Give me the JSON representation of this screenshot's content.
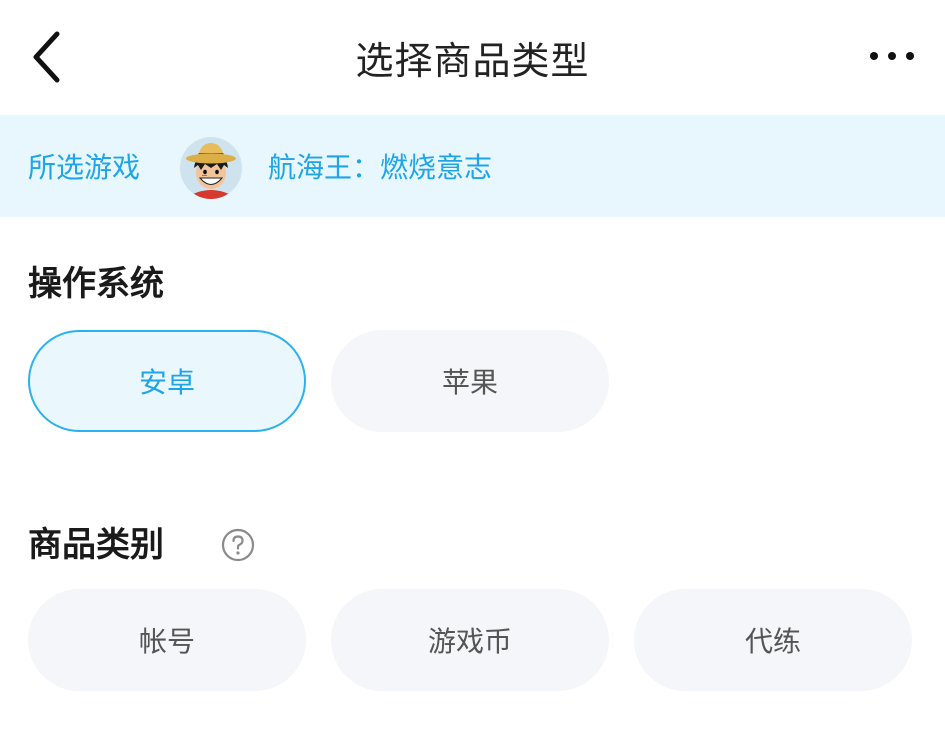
{
  "header": {
    "title": "选择商品类型",
    "back_icon": "chevron-left-icon",
    "more_icon": "more-dots-icon"
  },
  "selected_game": {
    "label": "所选游戏",
    "avatar_icon": "game-avatar",
    "name": "航海王：燃烧意志"
  },
  "os_section": {
    "title": "操作系统",
    "options": [
      {
        "label": "安卓",
        "selected": true
      },
      {
        "label": "苹果",
        "selected": false
      }
    ]
  },
  "category_section": {
    "title": "商品类别",
    "help_icon": "question-circle-icon",
    "options": [
      {
        "label": "帐号",
        "selected": false
      },
      {
        "label": "游戏币",
        "selected": false
      },
      {
        "label": "代练",
        "selected": false
      }
    ]
  },
  "colors": {
    "accent": "#1ea5e8",
    "accent-border": "#2bb1ef",
    "banner-bg": "#e8f6fd",
    "option-bg": "#f5f6f9",
    "selected-bg": "#eaf8fe"
  }
}
